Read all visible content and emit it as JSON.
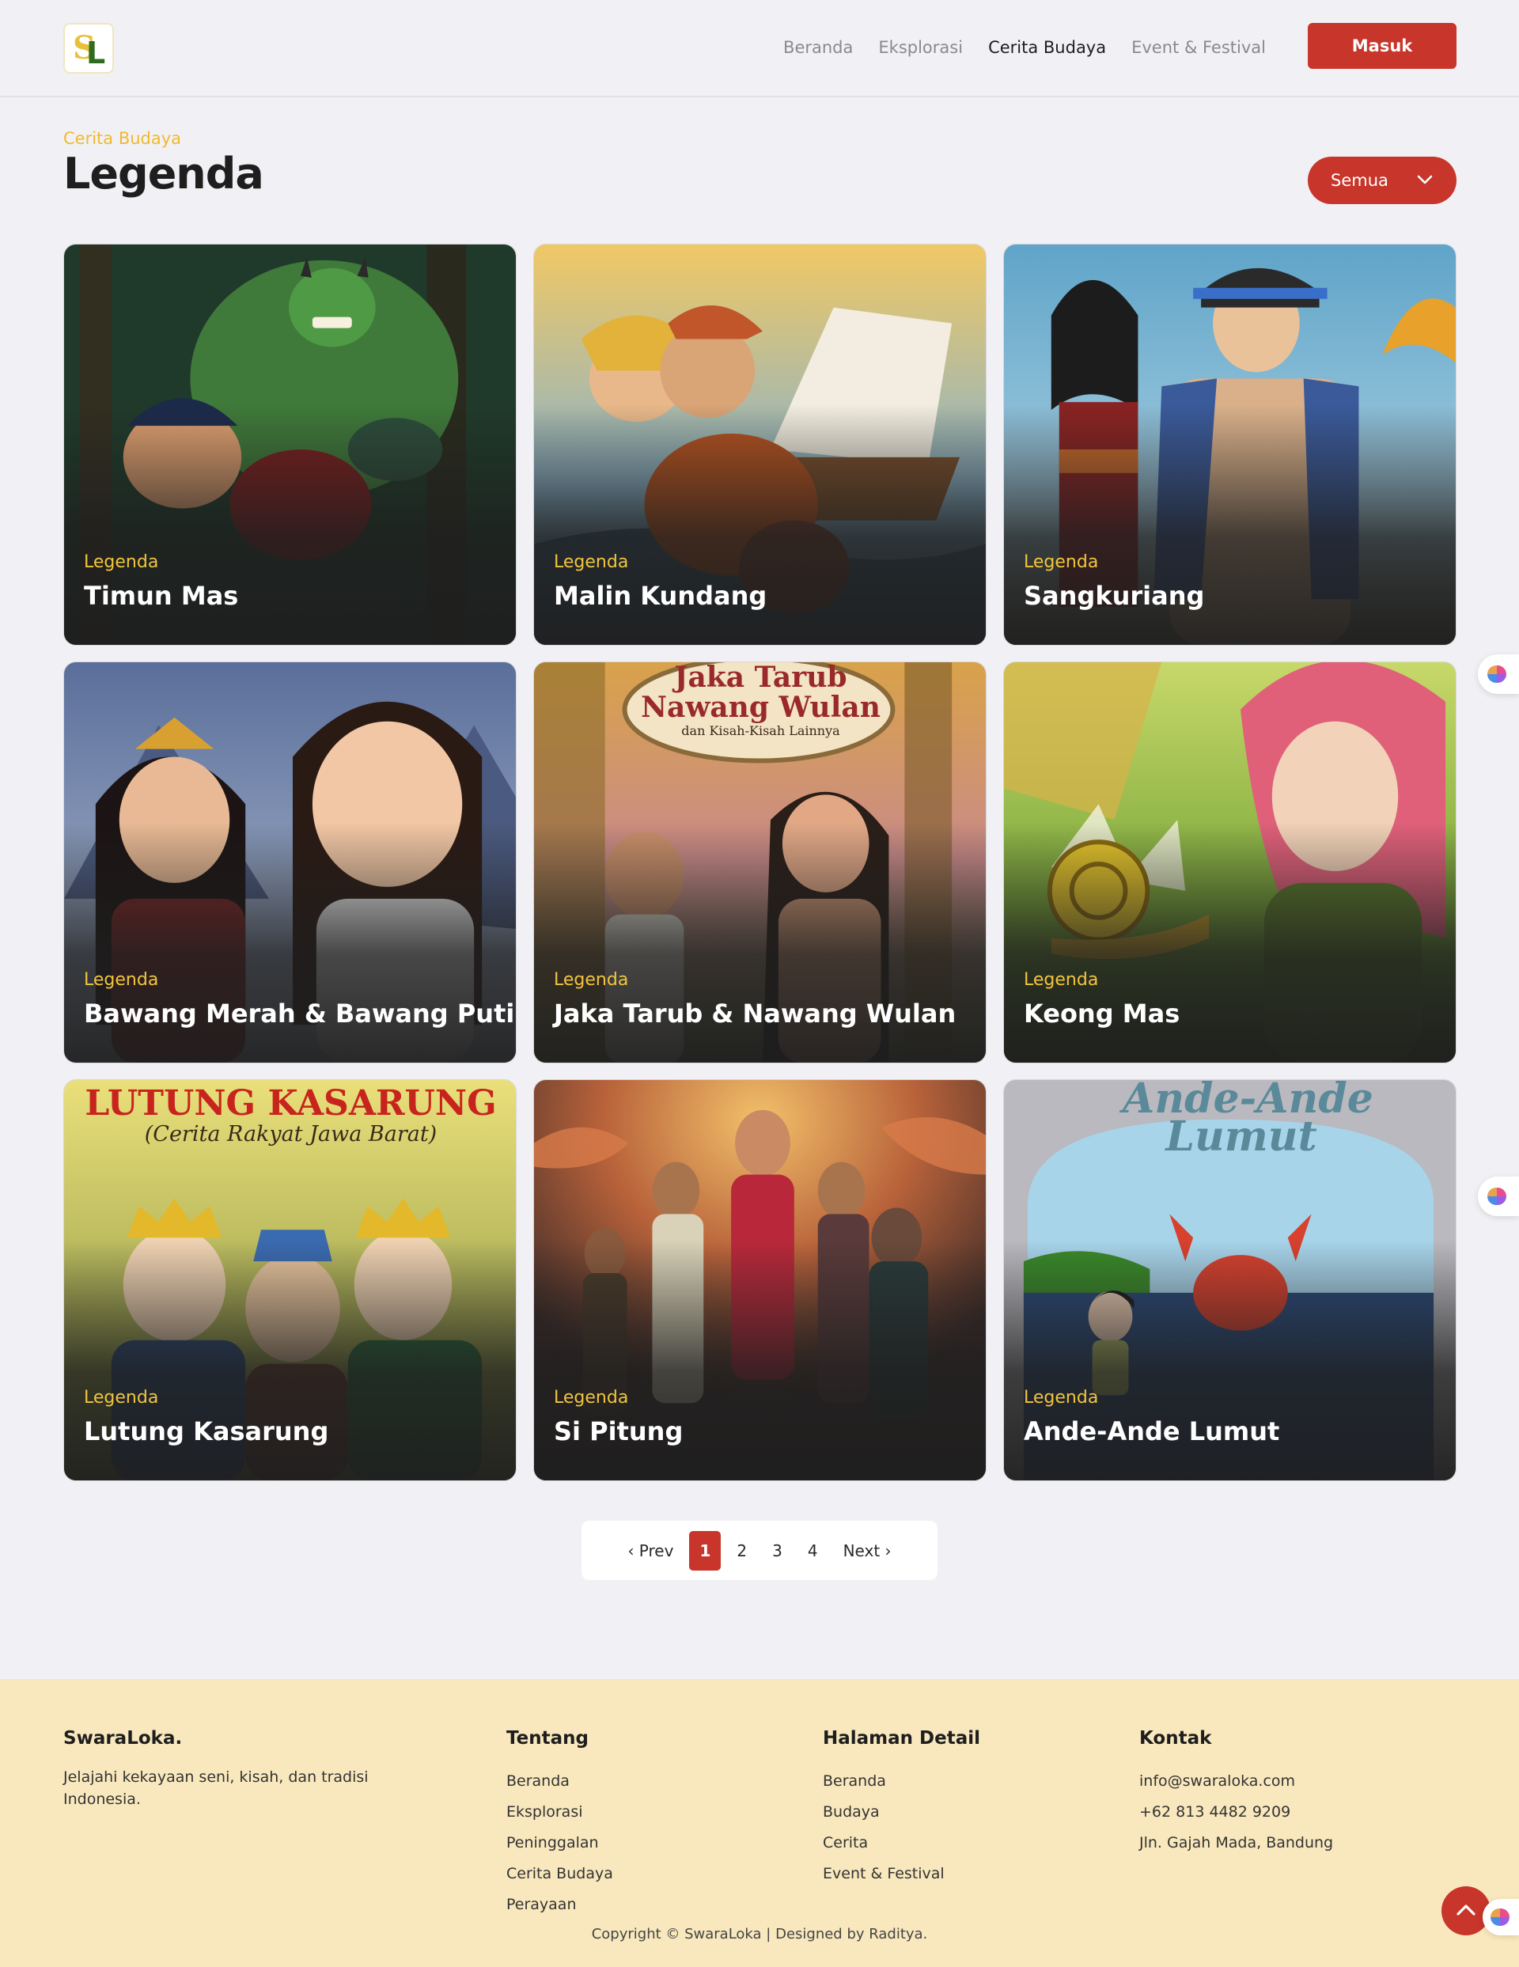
{
  "header": {
    "logo_text": "SL",
    "nav": [
      {
        "label": "Beranda",
        "active": false
      },
      {
        "label": "Eksplorasi",
        "active": false
      },
      {
        "label": "Cerita Budaya",
        "active": true
      },
      {
        "label": "Event & Festival",
        "active": false
      }
    ],
    "login_label": "Masuk"
  },
  "page": {
    "eyebrow": "Cerita Budaya",
    "title": "Legenda",
    "filter_value": "Semua"
  },
  "cards": [
    {
      "category": "Legenda",
      "title": "Timun Mas"
    },
    {
      "category": "Legenda",
      "title": "Malin Kundang"
    },
    {
      "category": "Legenda",
      "title": "Sangkuriang"
    },
    {
      "category": "Legenda",
      "title": "Bawang Merah & Bawang Putih"
    },
    {
      "category": "Legenda",
      "title": "Jaka Tarub & Nawang Wulan",
      "banner_line1": "Jaka Tarub",
      "banner_line2": "Nawang Wulan",
      "banner_line3": "dan Kisah-Kisah Lainnya"
    },
    {
      "category": "Legenda",
      "title": "Keong Mas"
    },
    {
      "category": "Legenda",
      "title": "Lutung Kasarung",
      "banner_line1": "LUTUNG KASARUNG",
      "banner_line2": "(Cerita Rakyat Jawa Barat)"
    },
    {
      "category": "Legenda",
      "title": "Si Pitung"
    },
    {
      "category": "Legenda",
      "title": "Ande-Ande Lumut",
      "banner_line1": "Ande-Ande",
      "banner_line2": "Lumut"
    }
  ],
  "pagination": {
    "prev": "‹ Prev",
    "pages": [
      "1",
      "2",
      "3",
      "4"
    ],
    "current": "1",
    "next": "Next ›"
  },
  "footer": {
    "brand": "SwaraLoka.",
    "description": "Jelajahi kekayaan seni, kisah, dan tradisi Indonesia.",
    "col1": {
      "heading": "Tentang",
      "items": [
        "Beranda",
        "Eksplorasi",
        "Peninggalan",
        "Cerita Budaya",
        "Perayaan"
      ]
    },
    "col2": {
      "heading": "Halaman Detail",
      "items": [
        "Beranda",
        "Budaya",
        "Cerita",
        "Event & Festival"
      ]
    },
    "col3": {
      "heading": "Kontak",
      "items": [
        "info@swaraloka.com",
        "+62 813 4482 9209",
        "Jln. Gajah Mada, Bandung"
      ]
    },
    "copyright": "Copyright © SwaraLoka | Designed by Raditya."
  },
  "colors": {
    "accent_red": "#c8352a",
    "accent_yellow": "#f0b92e",
    "footer_bg": "#f9e8bd",
    "page_bg": "#f1f1f5"
  },
  "icons": {
    "filter": "chevron-down-icon",
    "back_to_top": "chevron-up-icon",
    "side_widget": "brain-icon"
  }
}
